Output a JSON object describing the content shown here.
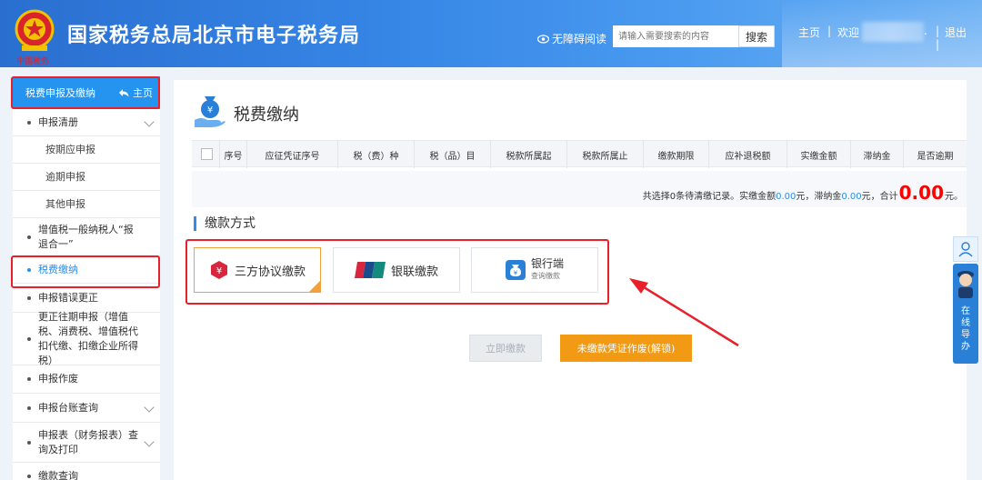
{
  "header": {
    "title": "国家税务总局北京市电子税务局",
    "emblem_caption": "中国税务",
    "accessible_reading": "无障碍阅读",
    "search_placeholder": "请输入需要搜索的内容",
    "search_button": "搜索",
    "home_link": "主页",
    "welcome": "欢迎",
    "logout": "退出"
  },
  "sidebar": {
    "header": "税费申报及缴纳",
    "home": "主页",
    "items": [
      {
        "label": "申报清册",
        "type": "parent"
      },
      {
        "label": "按期应申报",
        "type": "sub"
      },
      {
        "label": "逾期申报",
        "type": "sub"
      },
      {
        "label": "其他申报",
        "type": "sub"
      },
      {
        "label": "增值税一般纳税人“报退合一”",
        "type": "item"
      },
      {
        "label": "税费缴纳",
        "type": "active"
      },
      {
        "label": "申报错误更正",
        "type": "item"
      },
      {
        "label": "更正往期申报（增值税、消费税、增值税代扣代缴、扣缴企业所得税）",
        "type": "item"
      },
      {
        "label": "申报作废",
        "type": "item"
      },
      {
        "label": "申报台账查询",
        "type": "parent"
      },
      {
        "label": "申报表（财务报表）查询及打印",
        "type": "parent"
      },
      {
        "label": "缴款查询",
        "type": "item"
      }
    ]
  },
  "main": {
    "title": "税费缴纳",
    "columns": [
      "序号",
      "应征凭证序号",
      "税（费）种",
      "税（品）目",
      "税款所属起",
      "税款所属止",
      "缴款期限",
      "应补退税额",
      "实缴金额",
      "滞纳金",
      "是否逾期"
    ],
    "summary": {
      "prefix": "共选择0条待清缴记录。实缴金额",
      "paid": "0.00",
      "yuan1": "元，滞纳金",
      "late_fee": "0.00",
      "yuan2": "元，合计",
      "total": "0.00",
      "yuan3": "元。"
    },
    "section_title": "缴款方式",
    "payment_methods": [
      {
        "label": "三方协议缴款",
        "selected": true
      },
      {
        "label": "银联缴款",
        "selected": false
      },
      {
        "label": "银行端",
        "sub": "查询缴款",
        "selected": false
      }
    ],
    "pay_now": "立即缴款",
    "void_voucher": "未缴款凭证作废(解锁)"
  },
  "float": {
    "guide": [
      "在",
      "线",
      "导",
      "办"
    ]
  },
  "colors": {
    "primary": "#2593f0",
    "orange": "#f39a14",
    "annotation_red": "#e8202a",
    "unionpay_red": "#d7263d"
  }
}
